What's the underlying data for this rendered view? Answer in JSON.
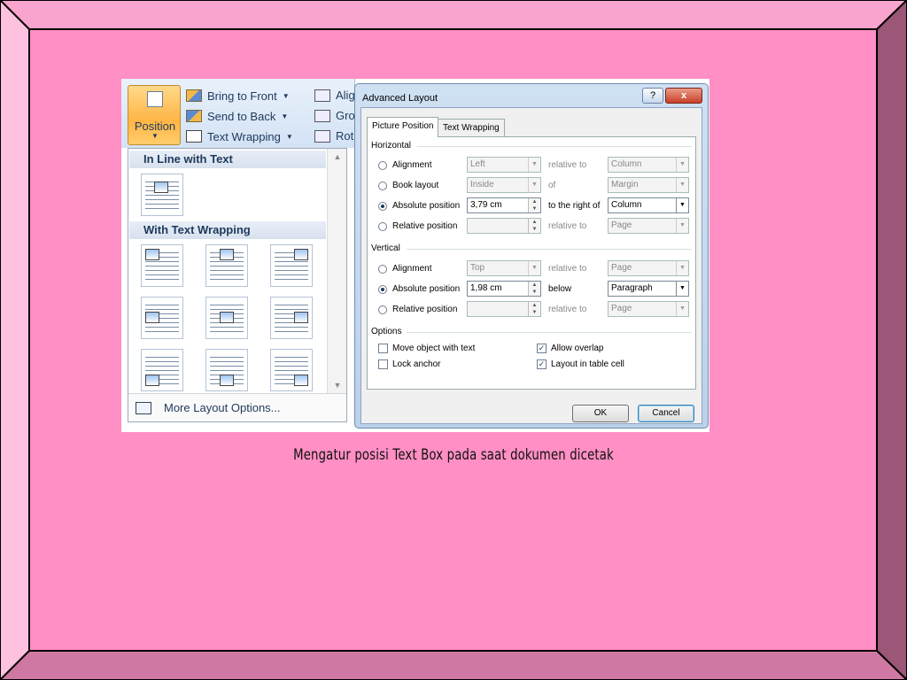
{
  "caption": "Mengatur posisi Text Box pada saat dokumen dicetak",
  "ribbon": {
    "position_label": "Position",
    "bring_to_front": "Bring to Front",
    "send_to_back": "Send to Back",
    "text_wrapping": "Text Wrapping",
    "align_partial": "Alig",
    "group_partial": "Gro",
    "rotate_partial": "Rot"
  },
  "panel": {
    "inline_header": "In Line with Text",
    "wrapping_header": "With Text Wrapping",
    "more_layout": "More Layout Options..."
  },
  "dialog": {
    "title": "Advanced Layout",
    "help": "?",
    "close": "x",
    "tabs": [
      "Picture Position",
      "Text Wrapping"
    ],
    "horizontal": {
      "header": "Horizontal",
      "rows": [
        {
          "label": "Alignment",
          "value": "Left",
          "mid": "relative to",
          "target": "Column",
          "selected": false
        },
        {
          "label": "Book layout",
          "value": "Inside",
          "mid": "of",
          "target": "Margin",
          "selected": false
        },
        {
          "label": "Absolute position",
          "value": "3,79 cm",
          "mid": "to the right of",
          "target": "Column",
          "selected": true
        },
        {
          "label": "Relative position",
          "value": "",
          "mid": "relative to",
          "target": "Page",
          "selected": false
        }
      ]
    },
    "vertical": {
      "header": "Vertical",
      "rows": [
        {
          "label": "Alignment",
          "value": "Top",
          "mid": "relative to",
          "target": "Page",
          "selected": false
        },
        {
          "label": "Absolute position",
          "value": "1,98 cm",
          "mid": "below",
          "target": "Paragraph",
          "selected": true
        },
        {
          "label": "Relative position",
          "value": "",
          "mid": "relative to",
          "target": "Page",
          "selected": false
        }
      ]
    },
    "options": {
      "header": "Options",
      "move_object": "Move object with text",
      "lock_anchor": "Lock anchor",
      "allow_overlap": "Allow overlap",
      "layout_in_table": "Layout in table cell"
    },
    "ok": "OK",
    "cancel": "Cancel"
  },
  "colors": {
    "slide_pink": "#ff8fc4",
    "frame_top": "#f9a4cf",
    "frame_left": "#ffc1e0",
    "frame_right": "#9c5677",
    "frame_bottom": "#cf78a3"
  }
}
